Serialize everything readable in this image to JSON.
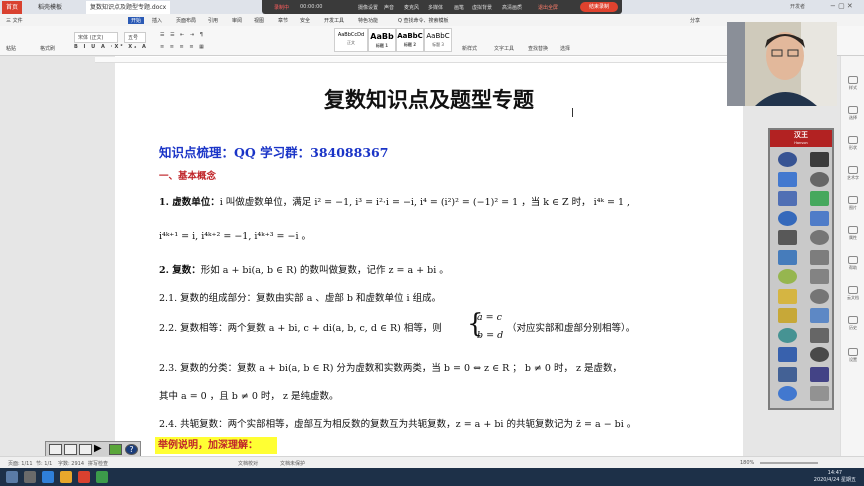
{
  "titlebar": {
    "tabs": [
      "首页",
      "稻壳模板",
      "复数知识点及题型专题.docx"
    ],
    "user": "开发者"
  },
  "recorder": {
    "status": "录制中",
    "time": "00:00:00",
    "items": [
      "摄像设置",
      "声音",
      "麦克风",
      "多媒体",
      "画笔",
      "虚拟背景",
      "高清画质",
      "退出全屏"
    ],
    "end_label": "结束录制"
  },
  "menubar": {
    "items": [
      "三 文件",
      "开始",
      "插入",
      "页面布局",
      "引用",
      "审阅",
      "视图",
      "章节",
      "安全",
      "开发工具",
      "特色功能",
      "Q 查找命令、搜索模板"
    ],
    "share": "分享"
  },
  "ribbon": {
    "groups": [
      "粘贴",
      "格式刷",
      "宋体 (正文)",
      "五号",
      "正文",
      "标题 1",
      "标题 2",
      "标题 3",
      "新样式",
      "文字工具",
      "查找替换",
      "选择"
    ],
    "styles": [
      {
        "sample": "AaBbCcDd",
        "name": "正文"
      },
      {
        "sample": "AaBb",
        "name": "标题 1"
      },
      {
        "sample": "AaBbC",
        "name": "标题 2"
      },
      {
        "sample": "AaBbC",
        "name": "标题 3"
      }
    ]
  },
  "doc": {
    "title": "复数知识点及题型专题",
    "heading": "知识点梳理：QQ 学习群：384088367",
    "section": "一、基本概念",
    "lines": [
      {
        "label": "1.  虚数单位：",
        "text": "i 叫做虚数单位，满足 i² = −1, i³ = i²·i = −i, i⁴ = (i²)² = (−1)² = 1 ，当 k ∈ Z 时，  i⁴ᵏ = 1 ,"
      },
      {
        "label": "",
        "text": "i⁴ᵏ⁺¹ = i, i⁴ᵏ⁺² = −1, i⁴ᵏ⁺³ = −i 。"
      },
      {
        "label": "2.  复数：",
        "text": "形如 a + bi(a, b ∈ R) 的数叫做复数，记作 z = a + bi 。"
      },
      {
        "label": "2.1.",
        "text": "复数的组成部分：复数由实部 a 、虚部 b 和虚数单位 i 组成。"
      },
      {
        "label": "2.2.",
        "text": "复数相等：两个复数 a + bi, c + di(a, b, c, d ∈ R) 相等，则"
      },
      {
        "label": "2.3.",
        "text": "复数的分类：复数 a + bi(a, b ∈ R) 分为虚数和实数两类，当 b = 0 ⇔ z ∈ R ； b ≠ 0 时， z 是虚数，"
      },
      {
        "label": "",
        "text": "其中 a = 0 ，且 b ≠ 0 时， z 是纯虚数。"
      },
      {
        "label": "2.4.",
        "text": "共轭复数：两个实部相等，虚部互为相反数的复数互为共轭复数，z = a + bi 的共轭复数记为 z̄ = a − bi 。"
      }
    ],
    "system_top": "a = c",
    "system_bottom": "b = d",
    "system_note": "（对应实部和虚部分别相等）。"
  },
  "example_label": "举例说明，加深理解：",
  "hanwang": {
    "brand": "汉王",
    "sub": "Hanvon"
  },
  "sidebar": {
    "items": [
      "样式",
      "选择",
      "形状",
      "艺术字",
      "图片",
      "属性",
      "帮助",
      "云文档",
      "历史",
      "设置"
    ]
  },
  "statusbar": {
    "items": [
      "页面: 1/11",
      "节: 1/1",
      "字数: 2914",
      "拼写检查",
      "文档校对",
      "文档未保护"
    ],
    "zoom": "180%"
  },
  "taskbar": {
    "time": "14:47",
    "date": "2020/4/24 星期五"
  },
  "colors": {
    "accent_blue": "#1a34c7",
    "accent_red": "#c0262a",
    "highlight": "#ffff33",
    "wps_red": "#d9412f"
  }
}
